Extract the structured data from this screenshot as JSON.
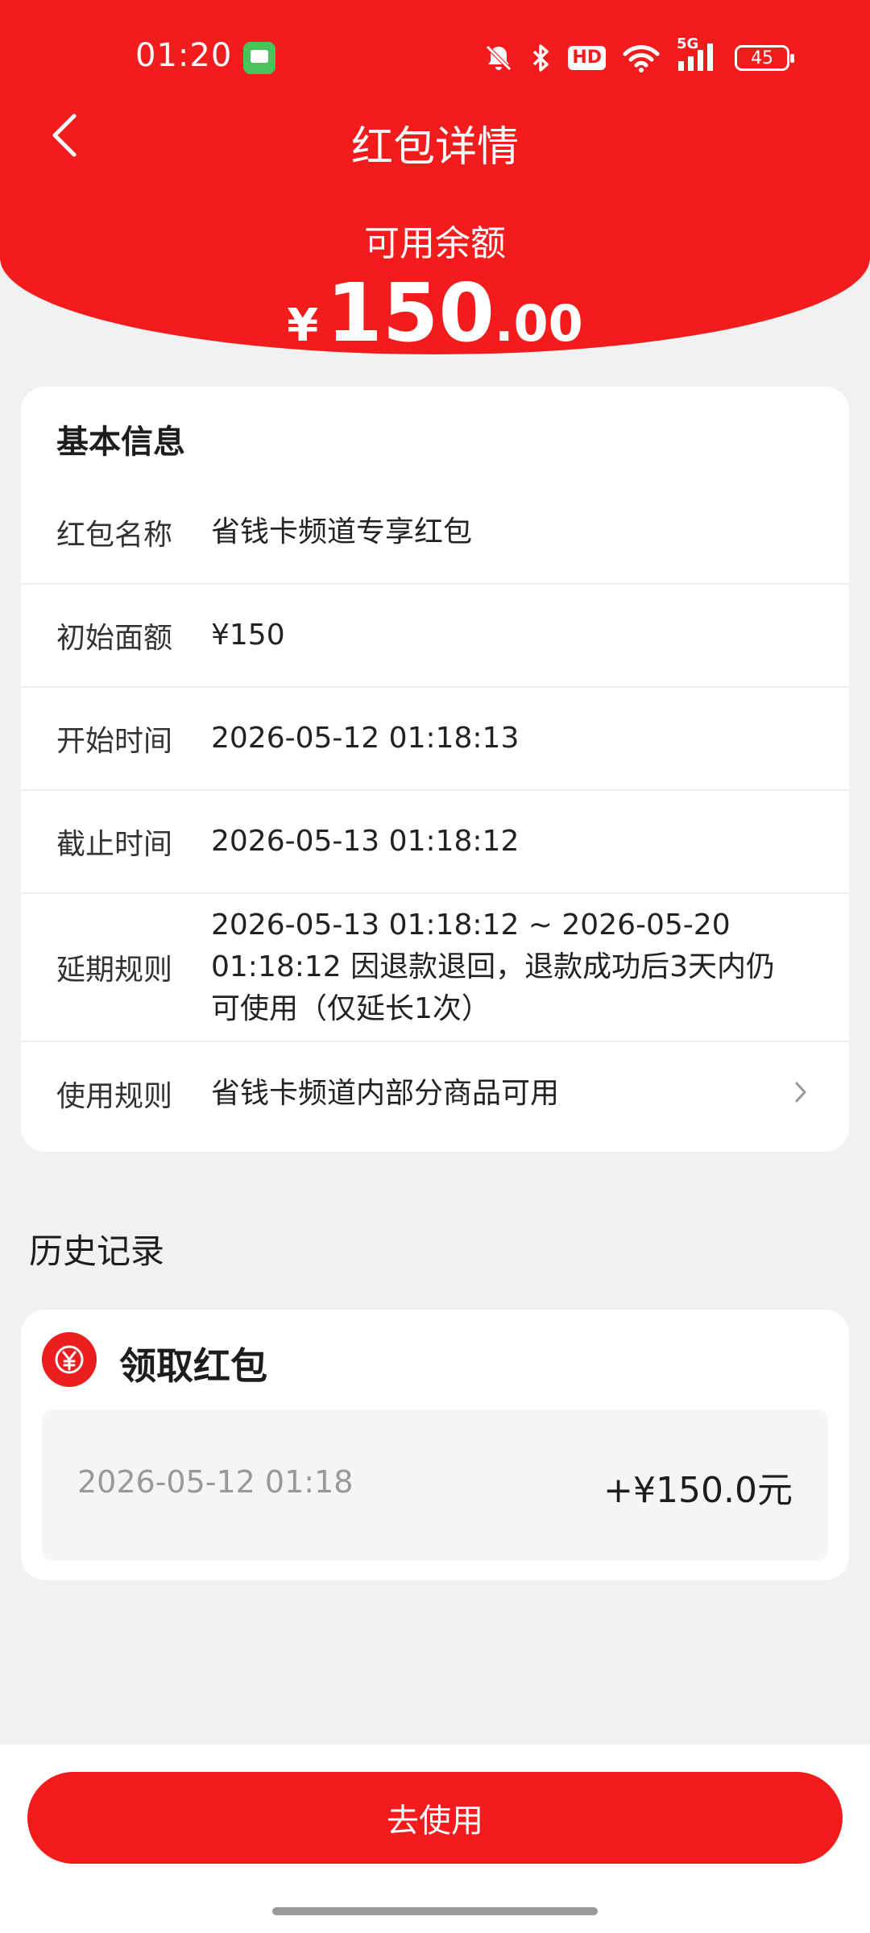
{
  "status_bar": {
    "time": "01:20",
    "network": "5G",
    "hd": "HD",
    "battery": "45"
  },
  "nav": {
    "title": "红包详情"
  },
  "balance": {
    "label": "可用余额",
    "currency": "¥",
    "integer": "150",
    "decimal": ".00"
  },
  "info": {
    "section_title": "基本信息",
    "rows": [
      {
        "label": "红包名称",
        "value": "省钱卡频道专享红包"
      },
      {
        "label": "初始面额",
        "value": "¥150"
      },
      {
        "label": "开始时间",
        "value": "2026-05-12 01:18:13"
      },
      {
        "label": "截止时间",
        "value": "2026-05-13 01:18:12"
      },
      {
        "label": "延期规则",
        "value": "2026-05-13 01:18:12 ~ 2026-05-20 01:18:12 因退款退回，退款成功后3天内仍可使用（仅延长1次）"
      },
      {
        "label": "使用规则",
        "value": "省钱卡频道内部分商品可用"
      }
    ]
  },
  "history": {
    "title": "历史记录",
    "record_type": "领取红包",
    "record_time": "2026-05-12 01:18",
    "record_amount": "+¥150.0元"
  },
  "bottom": {
    "use_button": "去使用"
  }
}
